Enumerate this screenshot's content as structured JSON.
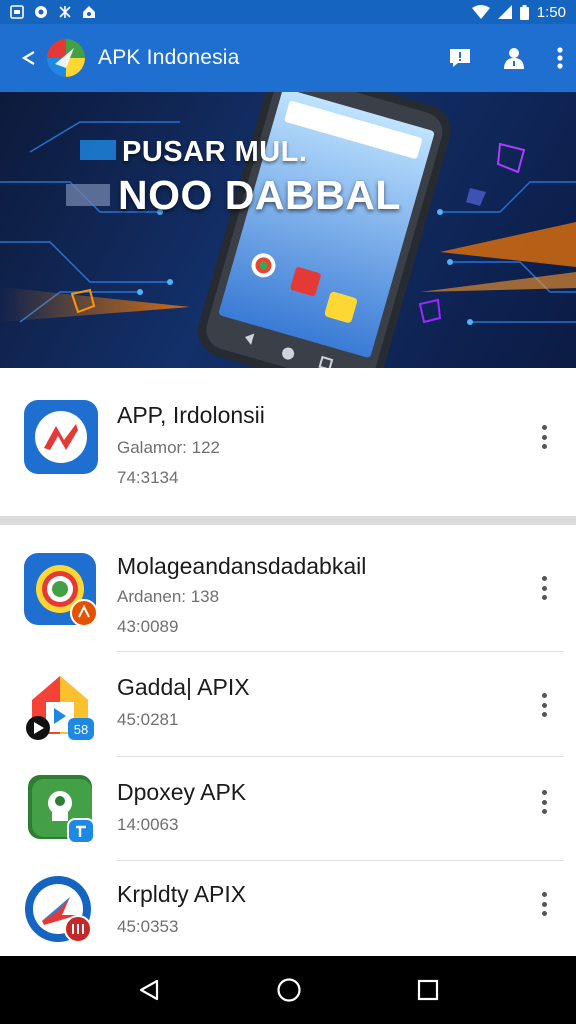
{
  "status_bar": {
    "time": "1:50",
    "left_icons": [
      "gallery-icon",
      "app-circle-icon",
      "settings-icon",
      "home-notify-icon"
    ],
    "right_icons": [
      "wifi-icon",
      "signal-icon",
      "battery-icon"
    ]
  },
  "app_bar": {
    "title": "APK Indonesia",
    "actions": [
      "feedback-icon",
      "account-icon",
      "more-vert-icon"
    ]
  },
  "banner": {
    "line1": "PUSAR MUL.",
    "line2": "NOO DABBAL"
  },
  "featured": {
    "name": "APP, Irdolonsii",
    "line1": "Galamor: 122",
    "line2": "74:3134"
  },
  "apps": [
    {
      "name": "Molageandansdadabkail",
      "line1": "Ardanen: 138",
      "line2": "43:0089",
      "icon": "compass-app-icon"
    },
    {
      "name": "Gadda| APIX",
      "line1": "",
      "line2": "45:0281",
      "icon": "home-app-icon"
    },
    {
      "name": "Dpoxey APK",
      "line1": "",
      "line2": "14:0063",
      "icon": "lock-app-icon"
    },
    {
      "name": "Krpldty APIX",
      "line1": "",
      "line2": "45:0353",
      "icon": "arrow-app-icon"
    }
  ],
  "colors": {
    "status_bar": "#1565c0",
    "app_bar": "#1e6fd0",
    "nav_bar": "#000000",
    "divider": "#dcdcdc"
  },
  "nav_bar": {
    "buttons": [
      "back-icon",
      "home-icon",
      "recents-icon"
    ]
  }
}
